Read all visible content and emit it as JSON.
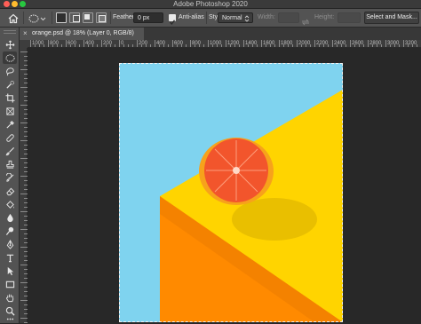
{
  "window": {
    "app_title": "Adobe Photoshop 2020",
    "traffic_colors": [
      "#ff5f57",
      "#febc2e",
      "#28c840"
    ]
  },
  "options_bar": {
    "feather_label": "Feather:",
    "feather_value": "0 px",
    "anti_alias_label": "Anti-alias",
    "anti_alias_checked": true,
    "style_label": "Style:",
    "style_value": "Normal",
    "width_label": "Width:",
    "height_label": "Height:",
    "select_and_mask_label": "Select and Mask..."
  },
  "document": {
    "tab_title": "orange.psd @ 18% (Layer 0, RGB/8)",
    "close_glyph": "×"
  },
  "ruler": {
    "top_labels": [
      "1000",
      "800",
      "600",
      "400",
      "200",
      "0",
      "200",
      "400",
      "600",
      "800",
      "1000",
      "1200",
      "1400",
      "1600",
      "1800",
      "2000",
      "2200",
      "2400",
      "2600",
      "2800",
      "3000",
      "3200",
      "3400"
    ]
  },
  "toolbar": {
    "tools": [
      "move-tool",
      "rectangular-marquee-tool",
      "lasso-tool",
      "quick-selection-tool",
      "crop-tool",
      "frame-tool",
      "eyedropper-tool",
      "healing-brush-tool",
      "brush-tool",
      "clone-stamp-tool",
      "history-brush-tool",
      "eraser-tool",
      "paint-bucket-tool",
      "blur-tool",
      "dodge-tool",
      "pen-tool",
      "type-tool",
      "path-selection-tool",
      "rectangle-tool",
      "hand-tool",
      "zoom-tool",
      "more-tools"
    ],
    "active_tool": "rectangular-marquee-tool"
  },
  "canvas": {
    "colors": {
      "sky": "#7fd3ef",
      "yellow": "#ffd400",
      "orange_face": "#ff8a00",
      "shadow": "#e2b800",
      "rind": "#f7a21b",
      "flesh": "#f2552c",
      "highlight": "#ff7a55",
      "accent": "#31a8ff"
    }
  }
}
